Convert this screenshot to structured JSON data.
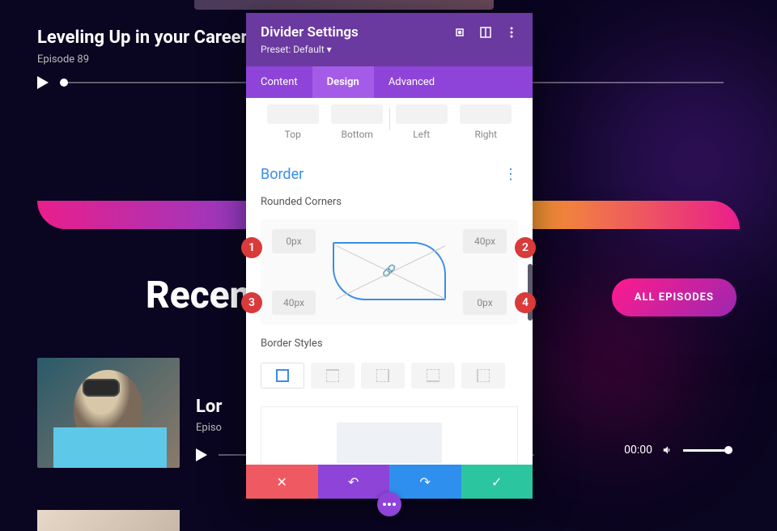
{
  "hero": {
    "title": "Leveling Up in your Career, w",
    "episode": "Episode 89"
  },
  "recent": {
    "heading": "Recent",
    "button": "ALL EPISODES"
  },
  "episode": {
    "title": "Lor",
    "sub": "Episo",
    "time": "00:00"
  },
  "modal": {
    "title": "Divider Settings",
    "preset": "Preset: Default ▾",
    "tabs": {
      "content": "Content",
      "design": "Design",
      "advanced": "Advanced"
    },
    "spacing": {
      "top": "Top",
      "bottom": "Bottom",
      "left": "Left",
      "right": "Right"
    },
    "border": {
      "title": "Border",
      "rounded_label": "Rounded Corners",
      "tl": "0px",
      "tr": "40px",
      "bl": "40px",
      "br": "0px",
      "styles_label": "Border Styles"
    }
  },
  "badges": {
    "b1": "1",
    "b2": "2",
    "b3": "3",
    "b4": "4"
  }
}
